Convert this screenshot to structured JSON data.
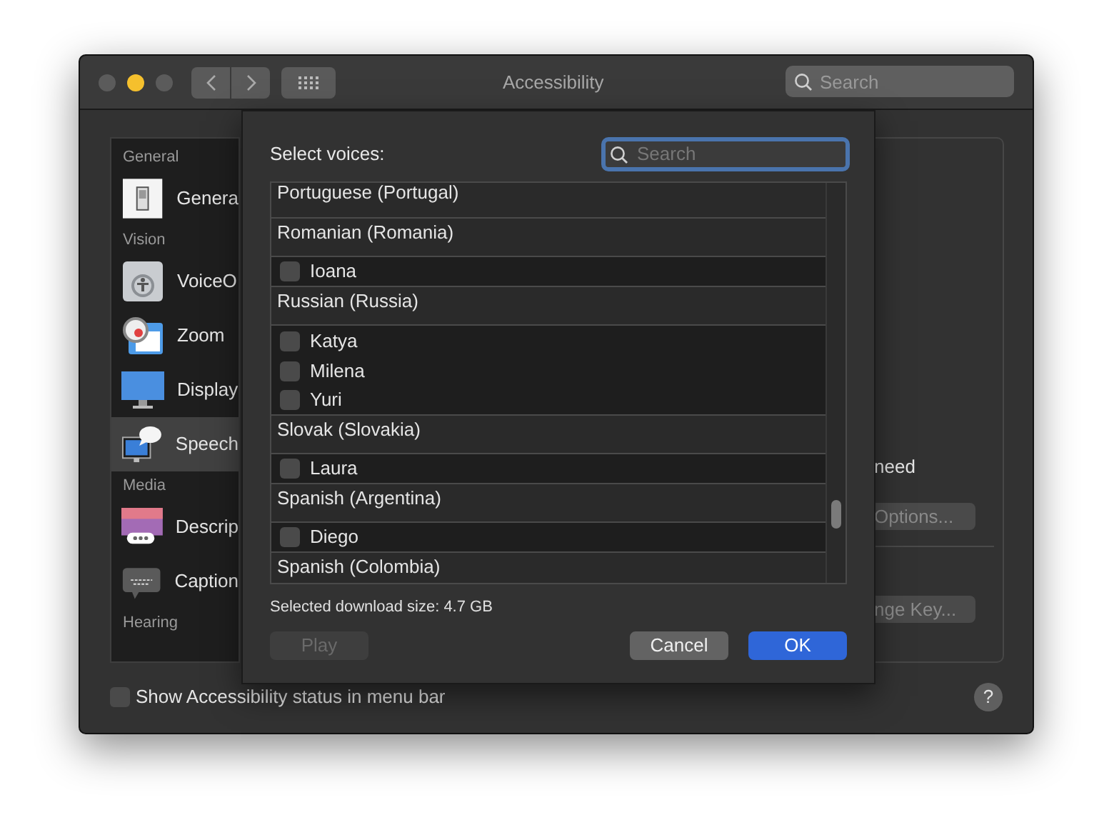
{
  "window": {
    "title": "Accessibility",
    "search": {
      "placeholder": "Search"
    }
  },
  "sidebar": {
    "items": [
      {
        "kind": "section",
        "label": "General"
      },
      {
        "kind": "item",
        "label": "Genera",
        "selected": false
      },
      {
        "kind": "section",
        "label": "Vision"
      },
      {
        "kind": "item",
        "label": "VoiceO",
        "selected": false
      },
      {
        "kind": "item",
        "label": "Zoom",
        "selected": false
      },
      {
        "kind": "item",
        "label": "Display",
        "selected": false
      },
      {
        "kind": "item",
        "label": "Speech",
        "selected": true
      },
      {
        "kind": "section",
        "label": "Media"
      },
      {
        "kind": "item",
        "label": "Descrip",
        "selected": false
      },
      {
        "kind": "item",
        "label": "Caption",
        "selected": false
      },
      {
        "kind": "section",
        "label": "Hearing"
      }
    ]
  },
  "right_pane": {
    "text": "need",
    "options_button": "Options...",
    "key_button": "nge Key..."
  },
  "status_checkbox": {
    "label": "Show Accessibility status in menu bar",
    "checked": false
  },
  "help_button": "?",
  "sheet": {
    "title": "Select voices:",
    "search": {
      "placeholder": "Search"
    },
    "voices": [
      {
        "kind": "header",
        "label": "Portuguese (Portugal)"
      },
      {
        "kind": "header",
        "label": "Romanian (Romania)"
      },
      {
        "kind": "voice",
        "label": "Ioana",
        "checked": false
      },
      {
        "kind": "header",
        "label": "Russian (Russia)"
      },
      {
        "kind": "voice",
        "label": "Katya",
        "checked": false
      },
      {
        "kind": "voice",
        "label": "Milena",
        "checked": false
      },
      {
        "kind": "voice",
        "label": "Yuri",
        "checked": false
      },
      {
        "kind": "header",
        "label": "Slovak (Slovakia)"
      },
      {
        "kind": "voice",
        "label": "Laura",
        "checked": false
      },
      {
        "kind": "header",
        "label": "Spanish (Argentina)"
      },
      {
        "kind": "voice",
        "label": "Diego",
        "checked": false
      },
      {
        "kind": "header",
        "label": "Spanish (Colombia)"
      }
    ],
    "download_size": "Selected download size: 4.7 GB",
    "buttons": [
      {
        "label": "Play",
        "kind": "secondary",
        "disabled": true
      },
      {
        "label": "Cancel",
        "kind": "secondary",
        "disabled": false
      },
      {
        "label": "OK",
        "kind": "primary",
        "disabled": false
      }
    ]
  }
}
